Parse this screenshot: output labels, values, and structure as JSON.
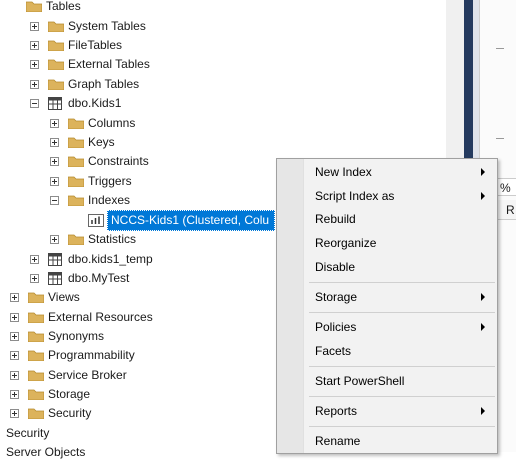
{
  "tree": {
    "tables": "Tables",
    "system_tables": "System Tables",
    "file_tables": "FileTables",
    "external_tables": "External Tables",
    "graph_tables": "Graph Tables",
    "dbo_kids1": "dbo.Kids1",
    "columns": "Columns",
    "keys": "Keys",
    "constraints": "Constraints",
    "triggers": "Triggers",
    "indexes": "Indexes",
    "index_item": "NCCS-Kids1 (Clustered, Colu",
    "statistics": "Statistics",
    "dbo_kids1_temp": "dbo.kids1_temp",
    "dbo_mytest": "dbo.MyTest",
    "views": "Views",
    "external_resources": "External Resources",
    "synonyms": "Synonyms",
    "programmability": "Programmability",
    "service_broker": "Service Broker",
    "storage": "Storage",
    "security_child": "Security",
    "security_root": "Security",
    "server_objects": "Server Objects"
  },
  "right_panel": {
    "percent": "%",
    "r_label": "R"
  },
  "context_menu": {
    "new_index": "New Index",
    "script_index_as": "Script Index as",
    "rebuild": "Rebuild",
    "reorganize": "Reorganize",
    "disable": "Disable",
    "storage": "Storage",
    "policies": "Policies",
    "facets": "Facets",
    "start_powershell": "Start PowerShell",
    "reports": "Reports",
    "rename": "Rename"
  },
  "colors": {
    "folder": "#dcb35c",
    "selection": "#0078d7"
  }
}
